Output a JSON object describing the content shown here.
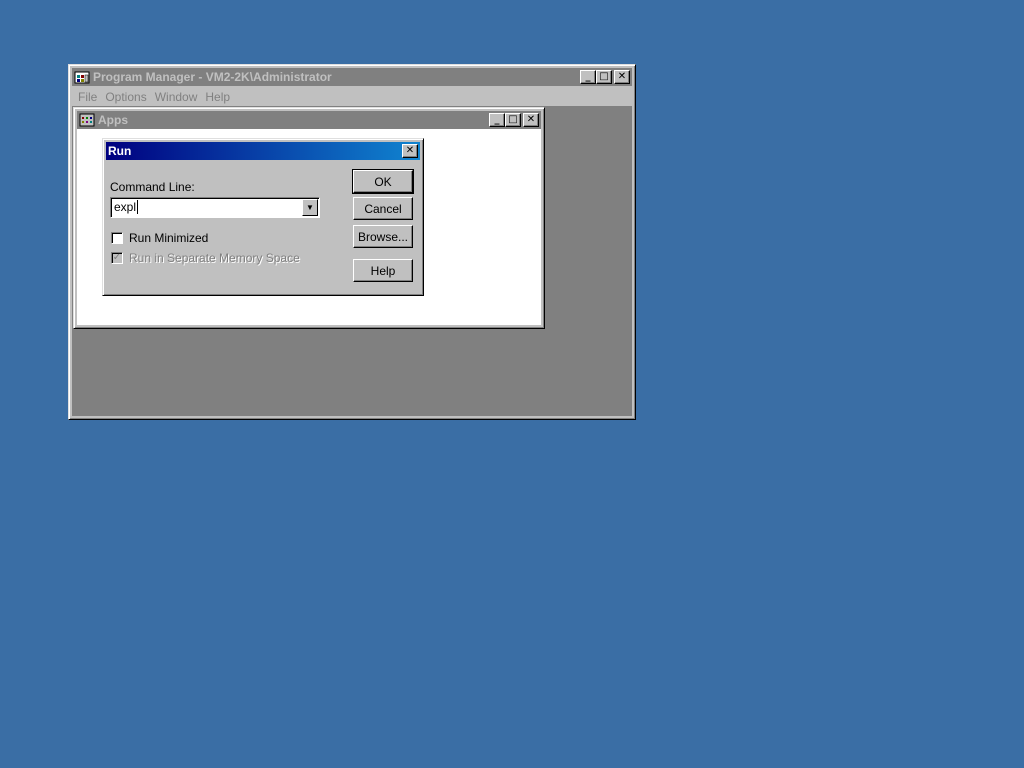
{
  "program_manager": {
    "title": "Program Manager - VM2-2K\\Administrator",
    "menu": [
      "File",
      "Options",
      "Window",
      "Help"
    ],
    "controls": {
      "minimize": "_",
      "maximize": "□",
      "close": "✕"
    }
  },
  "apps_window": {
    "title": "Apps",
    "controls": {
      "minimize": "_",
      "maximize": "□",
      "close": "✕"
    }
  },
  "run_dialog": {
    "title": "Run",
    "close": "✕",
    "command_line_label": "Command Line:",
    "command_value": "expl",
    "dropdown_arrow": "▼",
    "run_minimized_label": "Run Minimized",
    "run_minimized_checked": false,
    "separate_memory_label": "Run in Separate Memory Space",
    "separate_memory_checked": true,
    "separate_memory_enabled": false,
    "check_mark": "✓",
    "buttons": {
      "ok": "OK",
      "cancel": "Cancel",
      "browse": "Browse...",
      "help": "Help"
    }
  },
  "colors": {
    "desktop": "#3a6ea5",
    "active_title_start": "#000080",
    "active_title_end": "#1084d0",
    "inactive_title": "#808080",
    "window_face": "#c0c0c0"
  }
}
